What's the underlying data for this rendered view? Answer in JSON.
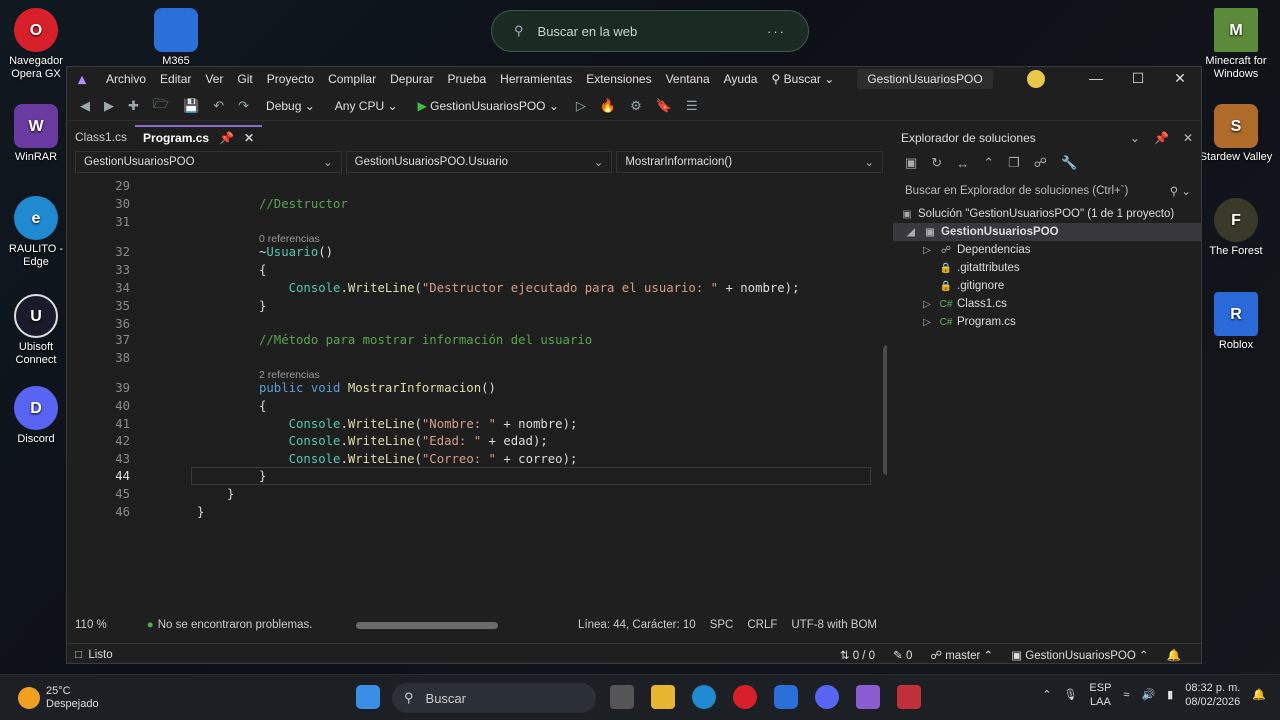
{
  "desktop": {
    "icons": [
      {
        "label": "Navegador Opera GX",
        "color": "#d8202a",
        "glyph": "O"
      },
      {
        "label": "WinRAR",
        "color": "#6a3aa0",
        "glyph": "W"
      },
      {
        "label": "RAULITO - Edge",
        "color": "#1f8ad0",
        "glyph": "e"
      },
      {
        "label": "Ubisoft Connect",
        "color": "#1a1a2a",
        "glyph": "U"
      },
      {
        "label": "Discord",
        "color": "#5865f2",
        "glyph": "D"
      },
      {
        "label": "M365",
        "color": "#2b6fd8",
        "glyph": "M"
      },
      {
        "label": "Minecraft for Windows",
        "color": "#5a8a3a",
        "glyph": "M"
      },
      {
        "label": "Stardew Valley",
        "color": "#b06a2a",
        "glyph": "S"
      },
      {
        "label": "The Forest",
        "color": "#3a3a2a",
        "glyph": "F"
      },
      {
        "label": "Roblox",
        "color": "#2a6ad8",
        "glyph": "R"
      }
    ],
    "web_search": {
      "placeholder": "Buscar en la web",
      "dots": "···"
    }
  },
  "vs": {
    "menu": [
      "Archivo",
      "Editar",
      "Ver",
      "Git",
      "Proyecto",
      "Compilar",
      "Depurar",
      "Prueba",
      "Herramientas",
      "Extensiones",
      "Ventana",
      "Ayuda"
    ],
    "search": "Buscar",
    "project_badge": "GestionUsuariosPOO",
    "toolbar": {
      "config": "Debug",
      "platform": "Any CPU",
      "run_target": "GestionUsuariosPOO"
    },
    "tabs": [
      {
        "label": "Class1.cs",
        "active": false
      },
      {
        "label": "Program.cs",
        "active": true
      }
    ],
    "navbar": [
      "GestionUsuariosPOO",
      "GestionUsuariosPOO.Usuario",
      "MostrarInformacion()"
    ],
    "code": {
      "lines": [
        {
          "n": "29",
          "html": ""
        },
        {
          "n": "30",
          "html": "<span class='cm'>//Destructor</span>"
        },
        {
          "n": "31",
          "html": ""
        },
        {
          "n": "32",
          "html": "<span class='pl'>~</span><span class='ty'>Usuario</span><span class='pl'>()</span>"
        },
        {
          "n": "33",
          "html": "<span class='pl'>{</span>"
        },
        {
          "n": "34",
          "html": "    <span class='ty'>Console</span><span class='pl'>.</span><span class='mt'>WriteLine</span><span class='pl'>(</span><span class='st'>\"Destructor ejecutado para el usuario: \"</span><span class='pl'> + nombre);</span>"
        },
        {
          "n": "35",
          "html": "<span class='pl'>}</span>"
        },
        {
          "n": "36",
          "html": ""
        },
        {
          "n": "37",
          "html": "<span class='cm'>//Método para mostrar información del usuario</span>"
        },
        {
          "n": "38",
          "html": ""
        },
        {
          "n": "39",
          "html": "<span class='kw'>public void </span><span class='mt'>MostrarInformacion</span><span class='pl'>()</span>"
        },
        {
          "n": "40",
          "html": "<span class='pl'>{</span>"
        },
        {
          "n": "41",
          "html": "    <span class='ty'>Console</span><span class='pl'>.</span><span class='mt'>WriteLine</span><span class='pl'>(</span><span class='st'>\"Nombre: \"</span><span class='pl'> + nombre);</span>"
        },
        {
          "n": "42",
          "html": "    <span class='ty'>Console</span><span class='pl'>.</span><span class='mt'>WriteLine</span><span class='pl'>(</span><span class='st'>\"Edad: \"</span><span class='pl'> + edad);</span>"
        },
        {
          "n": "43",
          "html": "    <span class='ty'>Console</span><span class='pl'>.</span><span class='mt'>WriteLine</span><span class='pl'>(</span><span class='st'>\"Correo: \"</span><span class='pl'> + correo);</span>"
        },
        {
          "n": "44",
          "html": "<span class='pl'>}</span>"
        },
        {
          "n": "45",
          "html": "<span class='pl'>}</span>"
        },
        {
          "n": "46",
          "html": "<span class='pl'>}</span>"
        }
      ],
      "ref_a": "0 referencias",
      "ref_b": "2 referencias"
    },
    "editor_status": {
      "zoom": "110 %",
      "problems": "No se encontraron problemas.",
      "position": "Línea: 44, Carácter: 10",
      "spc": "SPC",
      "crlf": "CRLF",
      "encoding": "UTF-8 with BOM"
    },
    "status": {
      "ready": "Listo",
      "sync": "0 / 0",
      "edits": "0",
      "branch": "master",
      "repo": "GestionUsuariosPOO"
    },
    "solution_explorer": {
      "title": "Explorador de soluciones",
      "search": "Buscar en Explorador de soluciones (Ctrl+`)",
      "solution": "Solución \"GestionUsuariosPOO\" (1 de 1 proyecto)",
      "project": "GestionUsuariosPOO",
      "items": [
        "Dependencias",
        ".gitattributes",
        ".gitignore",
        "Class1.cs",
        "Program.cs"
      ]
    }
  },
  "taskbar": {
    "temp": "25°C",
    "weather": "Despejado",
    "search": "Buscar",
    "lang1": "ESP",
    "lang2": "LAA",
    "time": "08:32 p. m.",
    "date": "08/02/2026"
  }
}
